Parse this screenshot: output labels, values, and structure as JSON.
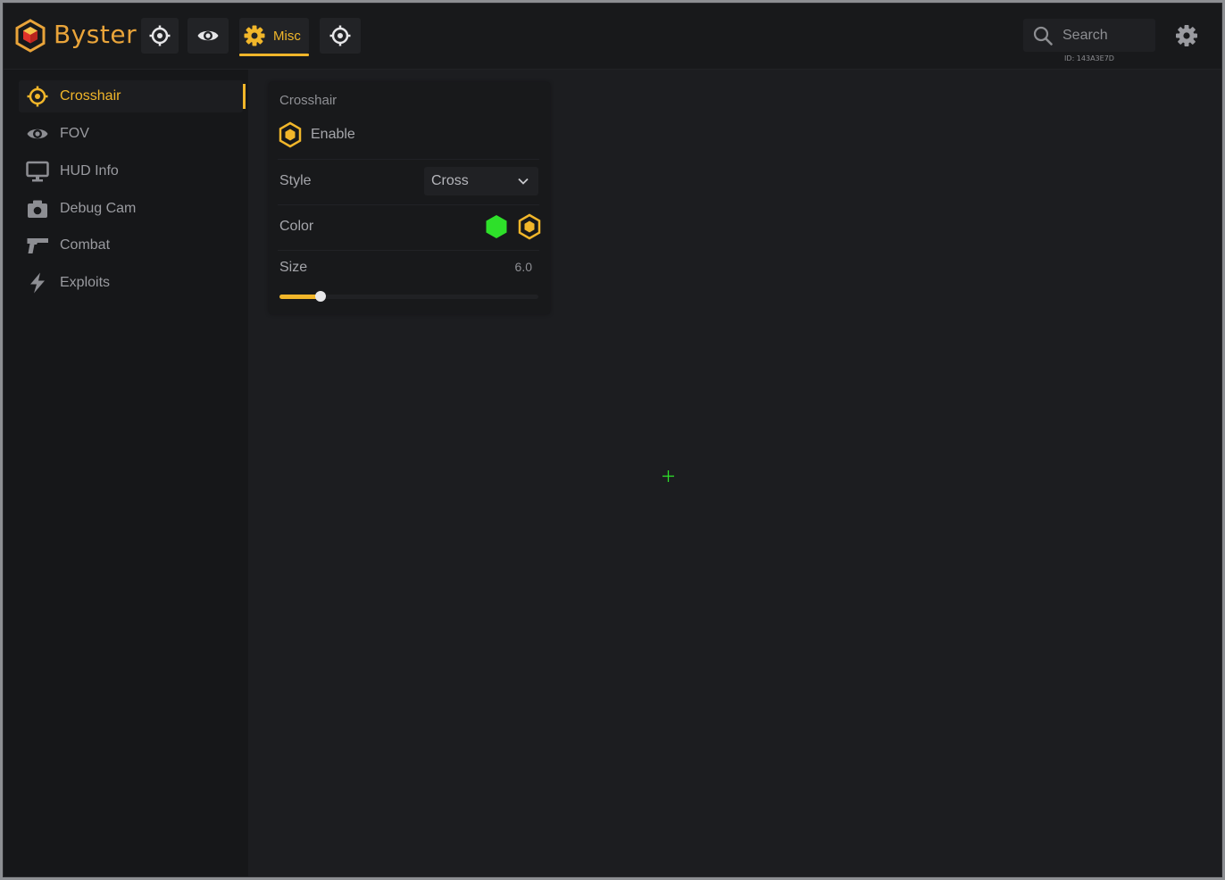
{
  "app": {
    "brand": "Byster",
    "logo_icon": "hexagon-cube-logo"
  },
  "top_tabs": [
    {
      "name": "aimbot",
      "icon": "crosshair-icon"
    },
    {
      "name": "visuals",
      "icon": "eye-icon"
    },
    {
      "name": "misc",
      "icon": "gear-icon",
      "label": "Misc",
      "active": true
    },
    {
      "name": "target",
      "icon": "crosshair-icon"
    }
  ],
  "search": {
    "placeholder": "Search",
    "value": "",
    "id_label": "ID: 143A3E7D"
  },
  "sidebar": {
    "items": [
      {
        "label": "Crosshair",
        "icon": "crosshair-icon",
        "active": true
      },
      {
        "label": "FOV",
        "icon": "eye-icon"
      },
      {
        "label": "HUD Info",
        "icon": "monitor-icon"
      },
      {
        "label": "Debug Cam",
        "icon": "camera-icon"
      },
      {
        "label": "Combat",
        "icon": "pistol-icon"
      },
      {
        "label": "Exploits",
        "icon": "lightning-icon"
      }
    ]
  },
  "panel": {
    "title": "Crosshair",
    "enable": {
      "label": "Enable",
      "checked": true
    },
    "style": {
      "label": "Style",
      "value": "Cross"
    },
    "color": {
      "label": "Color",
      "swatch_color": "#2ee02a",
      "accent_swatch": "#f1b62a"
    },
    "size": {
      "label": "Size",
      "value": "6.0",
      "fraction": 0.16
    }
  },
  "colors": {
    "accent": "#f1b62a",
    "brand": "#e9a43a",
    "crosshair": "#2ee02a",
    "background": "#1c1d20",
    "sidebar": "#161719"
  }
}
